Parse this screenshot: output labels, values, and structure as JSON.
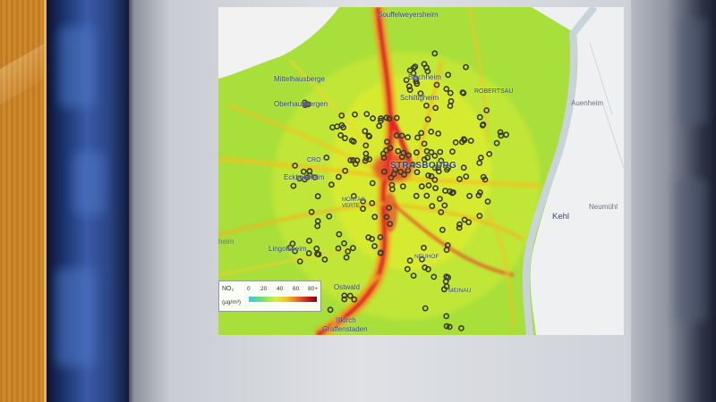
{
  "map": {
    "places": {
      "souffelweyersheim": "Souffelweyersheim",
      "mittelhausbergen": "Mittelhausberge",
      "oberhausbergen": "Oberhausbergen",
      "bischheim": "Bischheim",
      "schiltigheim": "Schiltigheim",
      "robertsau": "ROBERTSAU",
      "auenheim": "Auenheim",
      "strasbourg": "STRASBOURG",
      "cronenbourg": "CRO",
      "eckbolsheim": "Eckbolsheim",
      "montagne_verte": "MONTAG VERTE",
      "kehl": "Kehl",
      "neumuhl": "Neumühl",
      "lingolsheim": "Lingolsheim",
      "ostwald": "Ostwald",
      "neuhof": "NEUHOF",
      "meinau": "MEINAU",
      "illkirch": "Illkirch",
      "graffenstaden": "Graffenstaden",
      "heim": "heim"
    },
    "legend": {
      "pollutant": "NO₂",
      "unit": "(µg/m³)",
      "ticks": [
        "0",
        "20",
        "40",
        "60",
        "80+"
      ]
    },
    "colors": {
      "background_low": "#a8df3a",
      "road_hot": "#e5292a",
      "road_mid": "#f7b422",
      "river_zone": "#e8ecef",
      "sensor_ring": "#3a3a2a"
    }
  }
}
